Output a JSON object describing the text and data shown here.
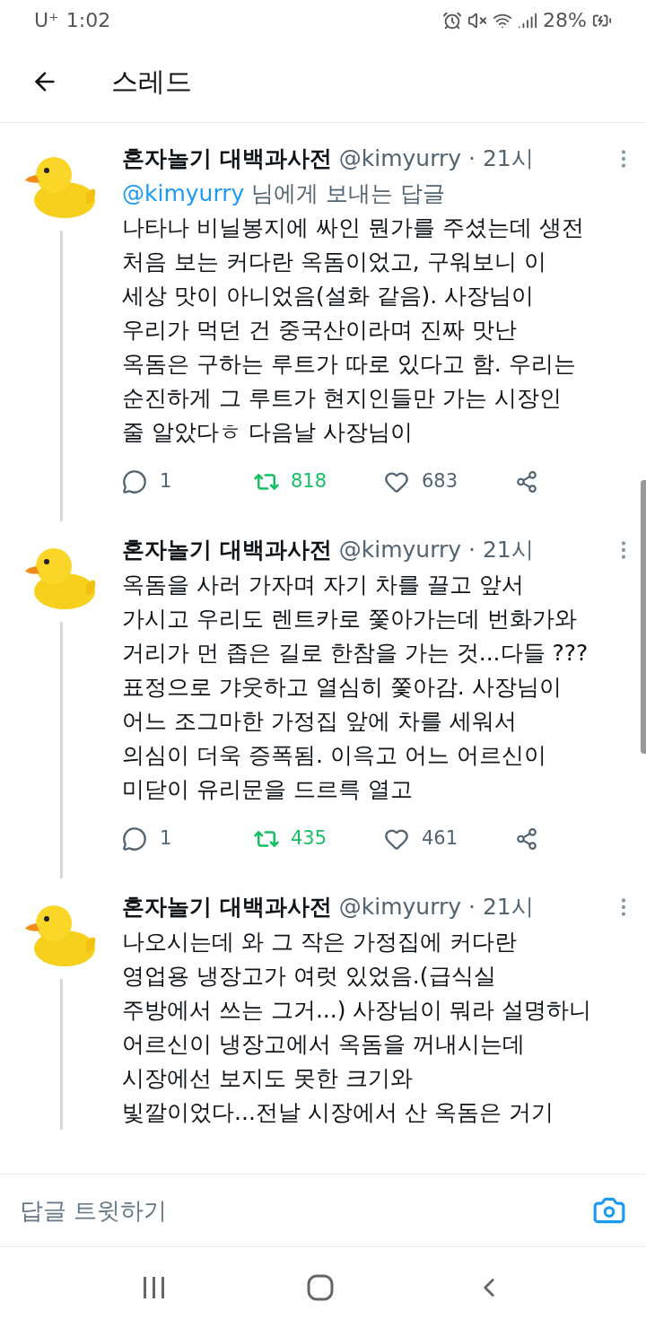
{
  "status_bar": {
    "carrier": "U⁺",
    "time": "1:02",
    "battery": "28%"
  },
  "header": {
    "title": "스레드"
  },
  "tweets": [
    {
      "name": "혼자놀기 대백과사전",
      "meta": "@kimyurry · 21시",
      "reply_to": {
        "mention": "@kimyurry",
        "text": "님에게 보내는 답글"
      },
      "body": "나타나 비닐봉지에 싸인 뭔가를 주셨는데 생전\n처음 보는 커다란 옥돔이었고, 구워보니 이\n세상 맛이 아니었음(설화 같음). 사장님이\n우리가 먹던 건 중국산이라며 진짜 맛난\n옥돔은 구하는 루트가 따로 있다고 함. 우리는\n순진하게 그 루트가 현지인들만 가는 시장인\n줄 알았다ㅎ 다음날 사장님이",
      "replies": "1",
      "retweets": "818",
      "retweeted": true,
      "likes": "683",
      "liked": false
    },
    {
      "name": "혼자놀기 대백과사전",
      "meta": "@kimyurry · 21시",
      "body": "옥돔을 사러 가자며 자기 차를 끌고 앞서\n가시고 우리도 렌트카로 쫓아가는데 번화가와\n거리가 먼 좁은 길로 한참을 가는 것...다들 ???\n표정으로 갸웃하고 열심히 쫓아감. 사장님이\n어느 조그마한 가정집 앞에 차를 세워서\n의심이 더욱 증폭됨. 이윽고 어느 어르신이\n미닫이 유리문을 드르륵 열고",
      "replies": "1",
      "retweets": "435",
      "retweeted": true,
      "likes": "461",
      "liked": false
    },
    {
      "name": "혼자놀기 대백과사전",
      "meta": "@kimyurry · 21시",
      "body": "나오시는데 와 그 작은 가정집에 커다란\n영업용 냉장고가 여럿 있었음.(급식실\n주방에서 쓰는 그거...) 사장님이 뭐라 설명하니\n어르신이 냉장고에서 옥돔을 꺼내시는데\n시장에선 보지도 못한 크기와\n빛깔이었다...전날 시장에서 산 옥돔은 거기"
    }
  ],
  "reply_bar": {
    "placeholder": "답글 트윗하기"
  }
}
